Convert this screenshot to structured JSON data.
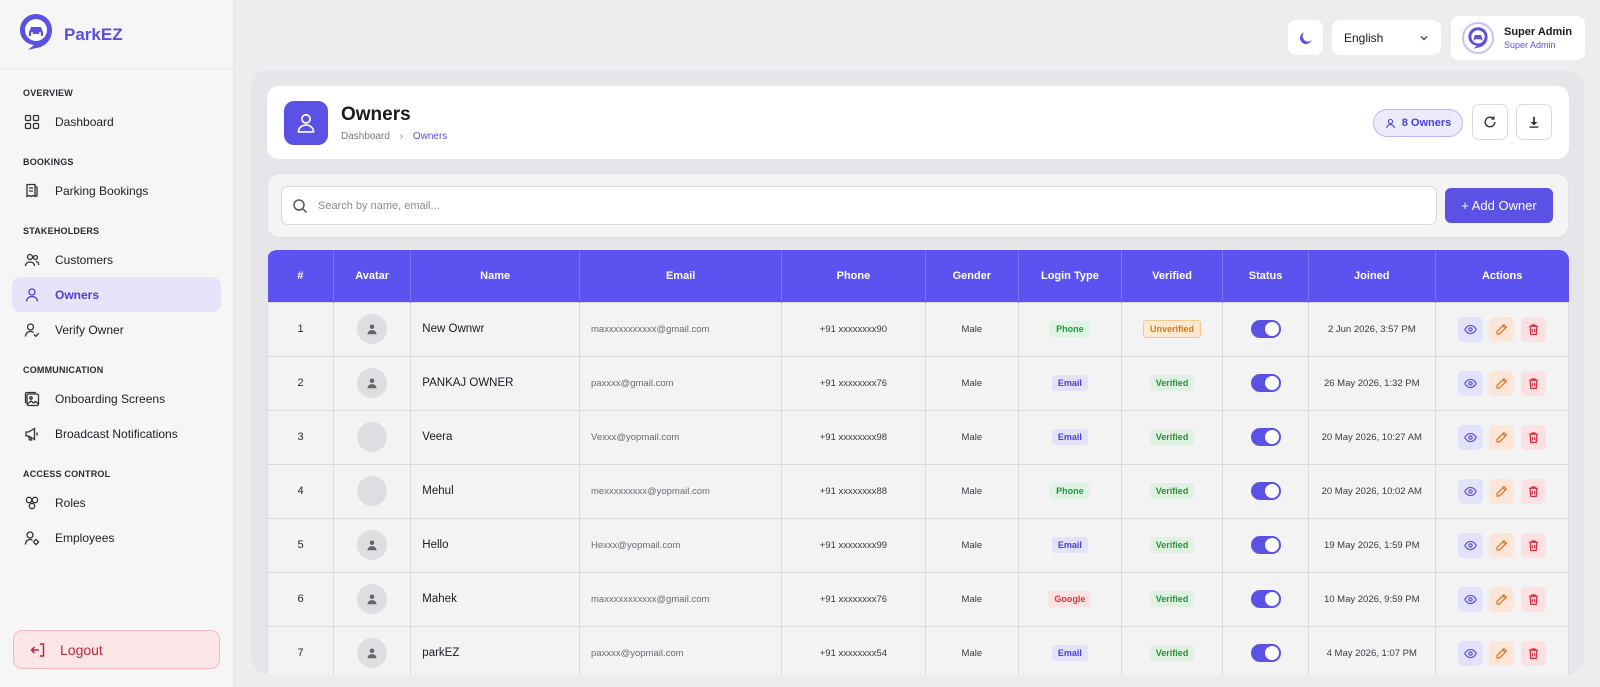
{
  "brand": {
    "name": "ParkEZ",
    "logo_icon": "parking-car-pin-icon"
  },
  "sidebar": {
    "sections": [
      {
        "title": "OVERVIEW",
        "items": [
          {
            "label": "Dashboard",
            "icon": "grid-icon",
            "active": false
          }
        ]
      },
      {
        "title": "BOOKINGS",
        "items": [
          {
            "label": "Parking Bookings",
            "icon": "receipt-icon",
            "active": false
          }
        ]
      },
      {
        "title": "STAKEHOLDERS",
        "items": [
          {
            "label": "Customers",
            "icon": "users-icon",
            "active": false
          },
          {
            "label": "Owners",
            "icon": "user-icon",
            "active": true
          },
          {
            "label": "Verify Owner",
            "icon": "user-check-icon",
            "active": false
          }
        ]
      },
      {
        "title": "COMMUNICATION",
        "items": [
          {
            "label": "Onboarding Screens",
            "icon": "images-icon",
            "active": false
          },
          {
            "label": "Broadcast Notifications",
            "icon": "megaphone-icon",
            "active": false
          }
        ]
      },
      {
        "title": "ACCESS CONTROL",
        "items": [
          {
            "label": "Roles",
            "icon": "roles-icon",
            "active": false
          },
          {
            "label": "Employees",
            "icon": "user-cog-icon",
            "active": false
          }
        ]
      }
    ],
    "logout_label": "Logout"
  },
  "topbar": {
    "theme_icon": "moon-icon",
    "language": "English",
    "user_name": "Super Admin",
    "user_role": "Super Admin"
  },
  "page": {
    "title": "Owners",
    "breadcrumb_root": "Dashboard",
    "breadcrumb_current": "Owners",
    "count_label": "8 Owners"
  },
  "search": {
    "placeholder": "Search by name, email...",
    "value": ""
  },
  "add_button_label": "+ Add Owner",
  "table": {
    "headers": [
      "#",
      "Avatar",
      "Name",
      "Email",
      "Phone",
      "Gender",
      "Login Type",
      "Verified",
      "Status",
      "Joined",
      "Actions"
    ],
    "rows": [
      {
        "idx": "1",
        "avatar": "person",
        "name": "New Ownwr",
        "email": "maxxxxxxxxxxx@gmail.com",
        "phone": "+91 xxxxxxxx90",
        "gender": "Male",
        "login": "Phone",
        "verified": "Unverified",
        "status_on": true,
        "joined": "2 Jun 2026, 3:57 PM"
      },
      {
        "idx": "2",
        "avatar": "person",
        "name": "PANKAJ OWNER",
        "email": "paxxxx@gmail.com",
        "phone": "+91 xxxxxxxx76",
        "gender": "Male",
        "login": "Email",
        "verified": "Verified",
        "status_on": true,
        "joined": "26 May 2026, 1:32 PM"
      },
      {
        "idx": "3",
        "avatar": "blank",
        "name": "Veera",
        "email": "Vexxx@yopmail.com",
        "phone": "+91 xxxxxxxx98",
        "gender": "Male",
        "login": "Email",
        "verified": "Verified",
        "status_on": true,
        "joined": "20 May 2026, 10:27 AM"
      },
      {
        "idx": "4",
        "avatar": "blank",
        "name": "Mehul",
        "email": "mexxxxxxxxx@yopmail.com",
        "phone": "+91 xxxxxxxx88",
        "gender": "Male",
        "login": "Phone",
        "verified": "Verified",
        "status_on": true,
        "joined": "20 May 2026, 10:02 AM"
      },
      {
        "idx": "5",
        "avatar": "person",
        "name": "Hello",
        "email": "Hexxx@yopmail.com",
        "phone": "+91 xxxxxxxx99",
        "gender": "Male",
        "login": "Email",
        "verified": "Verified",
        "status_on": true,
        "joined": "19 May 2026, 1:59 PM"
      },
      {
        "idx": "6",
        "avatar": "person",
        "name": "Mahek",
        "email": "maxxxxxxxxxxx@gmail.com",
        "phone": "+91 xxxxxxxx76",
        "gender": "Male",
        "login": "Google",
        "verified": "Verified",
        "status_on": true,
        "joined": "10 May 2026, 9:59 PM"
      },
      {
        "idx": "7",
        "avatar": "person",
        "name": "parkEZ",
        "email": "paxxxx@yopmail.com",
        "phone": "+91 xxxxxxxx54",
        "gender": "Male",
        "login": "Email",
        "verified": "Verified",
        "status_on": true,
        "joined": "4 May 2026, 1:07 PM"
      }
    ]
  },
  "colors": {
    "accent": "#5b52e5",
    "header": "#5b52f0",
    "sidebar_active": "#e5e4fb",
    "logout": "#c62434"
  }
}
